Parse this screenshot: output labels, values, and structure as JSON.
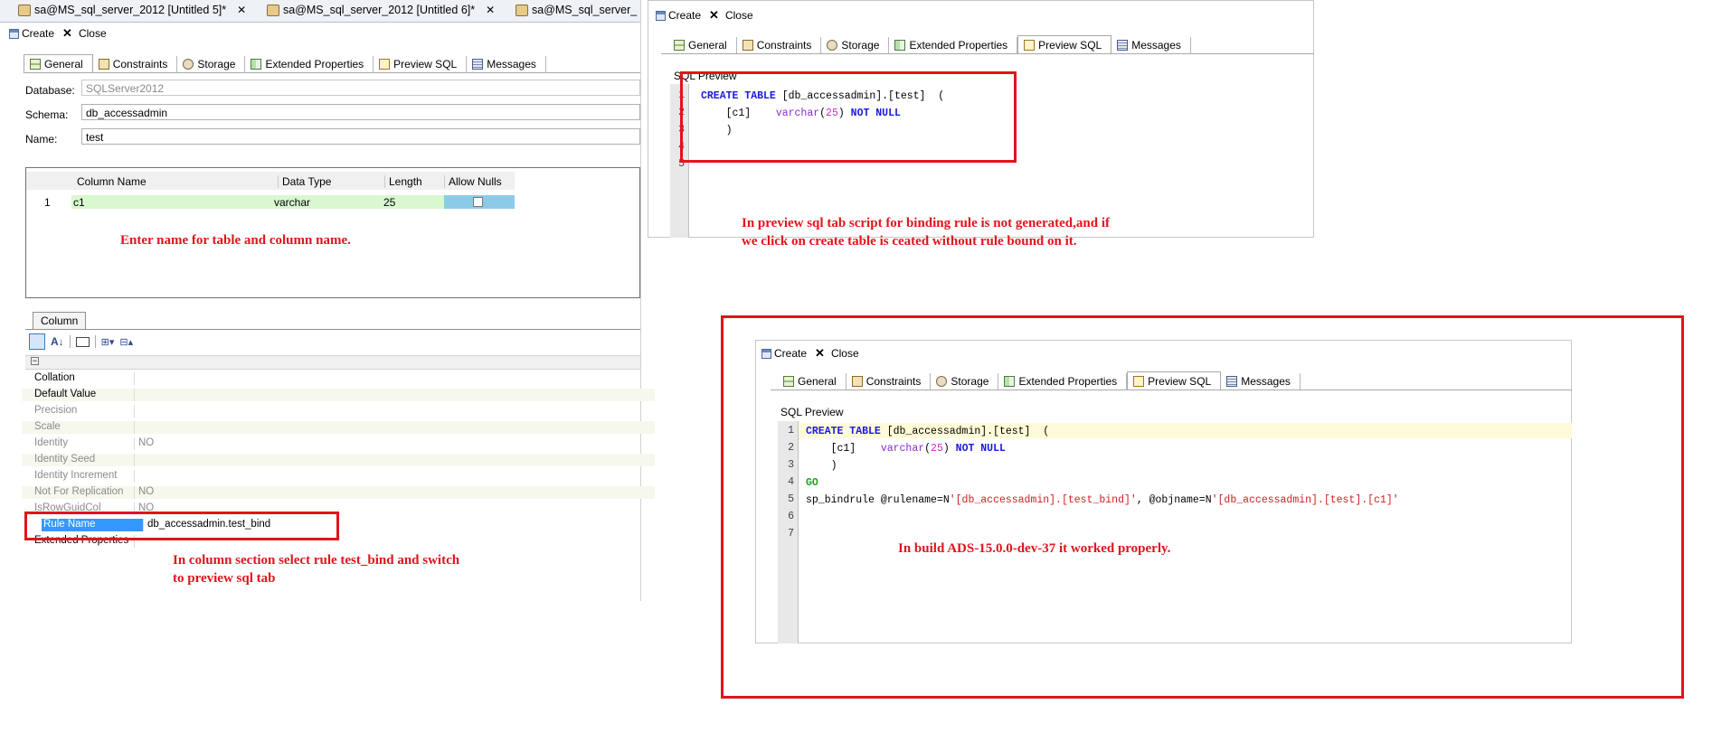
{
  "editor_tabs": [
    {
      "label": "sa@MS_sql_server_2012 [Untitled 5]*"
    },
    {
      "label": "sa@MS_sql_server_2012 [Untitled 6]*"
    },
    {
      "label": "sa@MS_sql_server_"
    }
  ],
  "toolbar": {
    "create": "Create",
    "close": "Close"
  },
  "tabs": [
    "General",
    "Constraints",
    "Storage",
    "Extended Properties",
    "Preview SQL",
    "Messages"
  ],
  "general": {
    "database_label": "Database:",
    "database_value": "SQLServer2012",
    "schema_label": "Schema:",
    "schema_value": "db_accessadmin",
    "name_label": "Name:",
    "name_value": "test"
  },
  "columns_table": {
    "headers": [
      "Column Name",
      "Data Type",
      "Length",
      "Allow Nulls"
    ],
    "rows": [
      {
        "num": "1",
        "name": "c1",
        "type": "varchar",
        "length": "25"
      }
    ]
  },
  "column_section": {
    "tab": "Column",
    "properties": [
      {
        "name": "Collation",
        "value": "",
        "dim": false
      },
      {
        "name": "Default Value",
        "value": "",
        "dim": false
      },
      {
        "name": "Precision",
        "value": "",
        "dim": true
      },
      {
        "name": "Scale",
        "value": "",
        "dim": true
      },
      {
        "name": "Identity",
        "value": "NO",
        "dim": true
      },
      {
        "name": "Identity Seed",
        "value": "",
        "dim": true
      },
      {
        "name": "Identity Increment",
        "value": "",
        "dim": true
      },
      {
        "name": "Not For Replication",
        "value": "NO",
        "dim": true
      },
      {
        "name": "IsRowGuidCol",
        "value": "NO",
        "dim": true
      },
      {
        "name": "Rule Name",
        "value": "db_accessadmin.test_bind",
        "dim": false
      },
      {
        "name": "Extended Properties",
        "value": "",
        "dim": false
      }
    ]
  },
  "sql_preview": {
    "label": "SQL Preview",
    "line_numbers_short": [
      "1",
      "2",
      "3",
      "4",
      "5"
    ],
    "line_numbers_long": [
      "1",
      "2",
      "3",
      "4",
      "5",
      "6",
      "7"
    ]
  },
  "annotations": {
    "enter_name": "Enter name for table and column name.",
    "select_rule_1": "In column section select rule test_bind and switch",
    "select_rule_2": "to preview sql tab",
    "preview_issue_1": "In preview sql tab script for binding rule is not generated,and if",
    "preview_issue_2": "we click on create table is ceated without rule bound on it.",
    "worked_build": "In build ADS-15.0.0-dev-37 it worked properly."
  },
  "colors": {
    "annotation_red": "#e0141c",
    "row_green": "#d8f8d0",
    "selection_blue": "#3399ff"
  }
}
